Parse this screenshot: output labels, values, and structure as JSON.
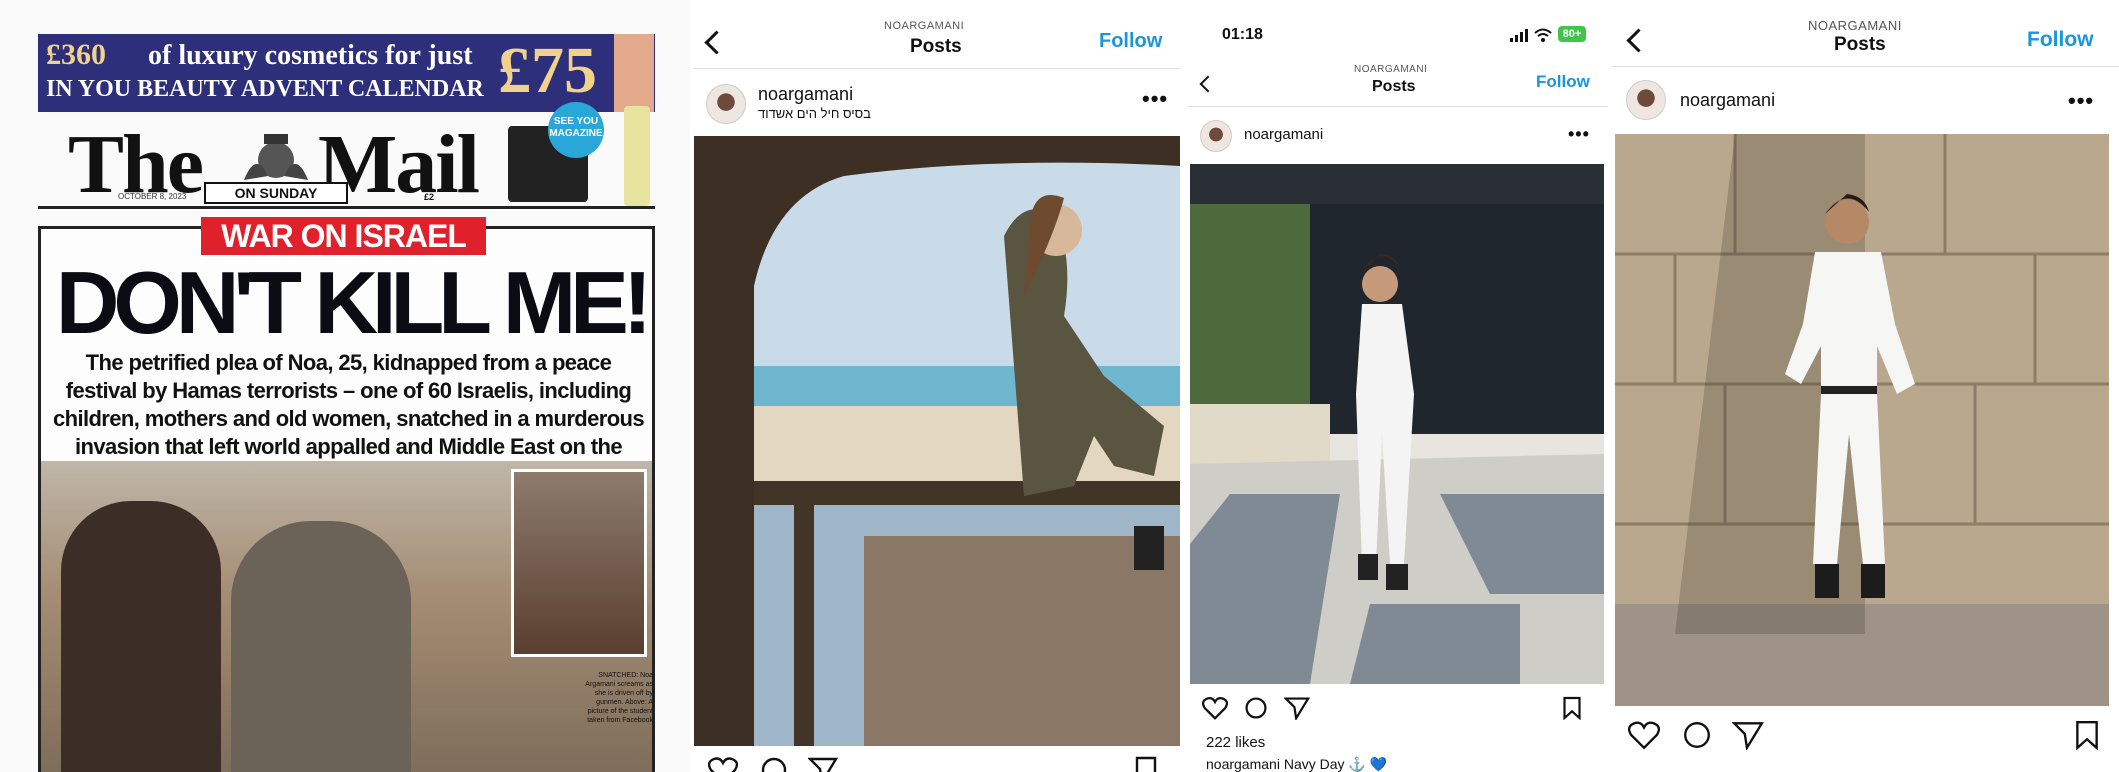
{
  "newspaper": {
    "ad_price": "£360",
    "ad_line1": "of luxury cosmetics for just",
    "ad_line2": "IN YOU BEAUTY ADVENT CALENDAR",
    "ad_price_big": "£75",
    "see_you": "SEE YOU MAGAZINE",
    "masthead_the": "The",
    "masthead_mail": "Mail",
    "on_sunday": "ON SUNDAY",
    "date": "OCTOBER 8, 2023",
    "price": "£2",
    "war_banner": "WAR ON ISRAEL",
    "headline": "DON'T KILL ME!",
    "standfirst": "The petrified plea of Noa, 25, kidnapped from a peace festival by Hamas terrorists – one of 60 Israelis, including children, mothers and old women, snatched in a murderous invasion that left world appalled and Middle East on the brink of all-out war",
    "caption": "SNATCHED: Noa Argamani screams as she is driven off by gunmen. Above: A picture of the student taken from Facebook"
  },
  "panel2": {
    "header_user": "NOARGAMANI",
    "header_title": "Posts",
    "follow": "Follow",
    "username": "noargamani",
    "location": "בסיס חיל הים אשדוד",
    "more": "•••"
  },
  "panel3": {
    "time": "01:18",
    "battery": "80+",
    "header_user": "NOARGAMANI",
    "header_title": "Posts",
    "follow": "Follow",
    "username": "noargamani",
    "more": "•••",
    "likes": "222 likes",
    "caption_user": "noargamani",
    "caption_text": "Navy Day ⚓ 💙"
  },
  "panel4": {
    "header_user": "NOARGAMANI",
    "header_title": "Posts",
    "follow": "Follow",
    "username": "noargamani",
    "more": "•••"
  },
  "colors": {
    "instagram_blue": "#1a95e0",
    "banner_red": "#e0202a",
    "ad_navy": "#2e2f7a"
  },
  "icons": [
    "back-chevron-icon",
    "heart-icon",
    "comment-icon",
    "share-icon",
    "bookmark-icon",
    "more-icon",
    "signal-icon",
    "wifi-icon",
    "battery-icon"
  ]
}
